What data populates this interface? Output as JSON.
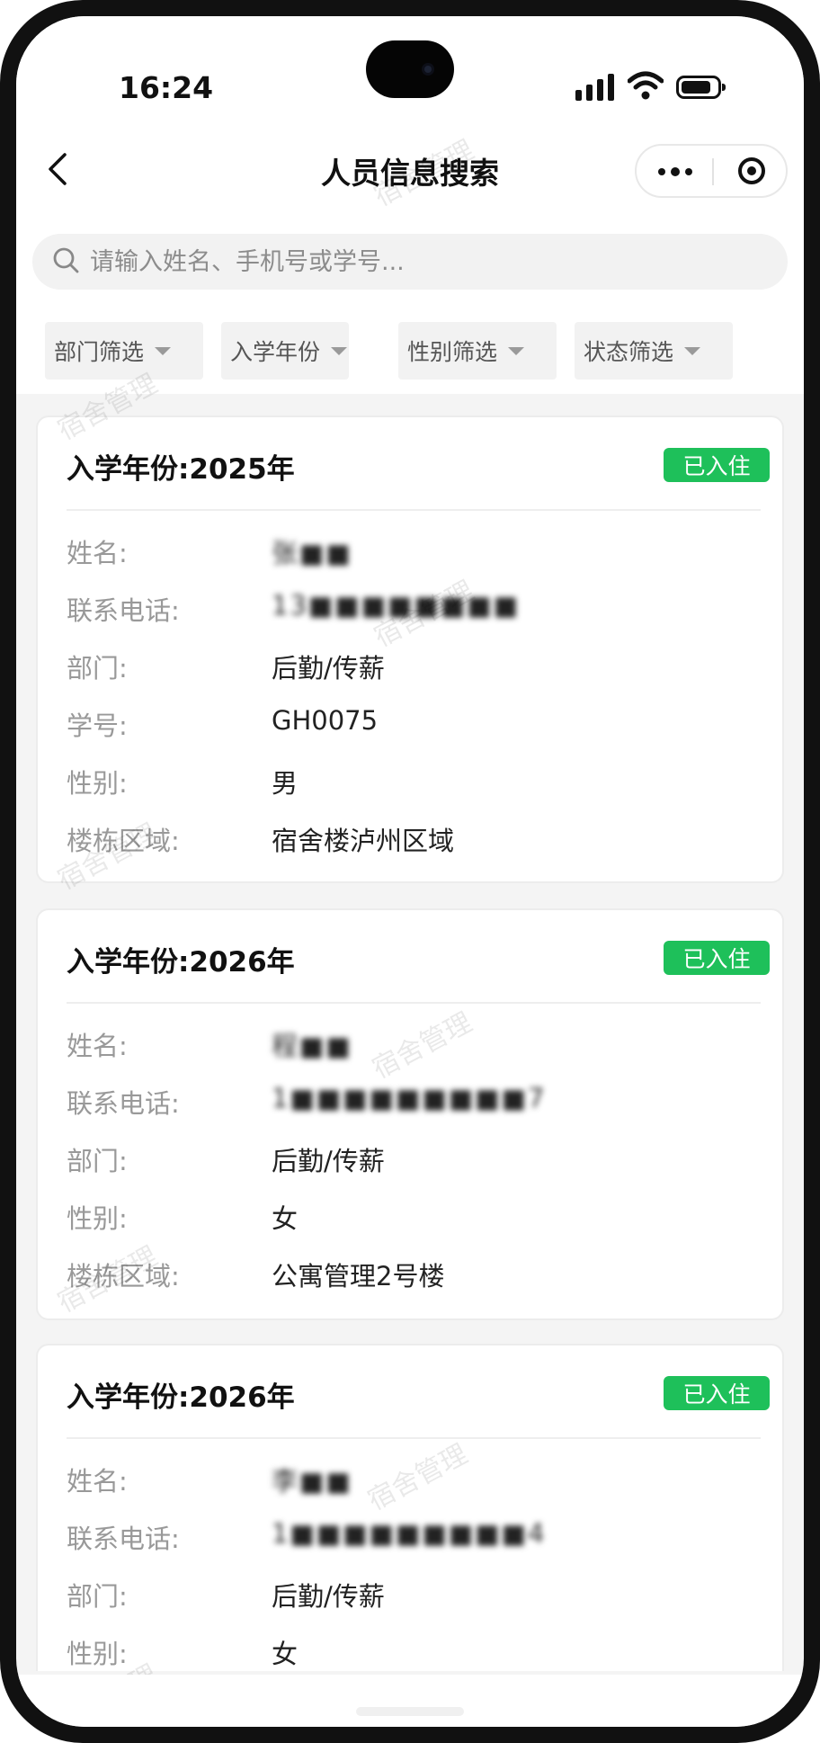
{
  "status_bar": {
    "time": "16:24",
    "battery_icon": "battery-icon",
    "signal_icon": "signal-icon",
    "wifi_icon": "wifi-icon"
  },
  "nav": {
    "title": "人员信息搜索",
    "back_icon": "back-chevron-icon",
    "more_icon": "more-dots-icon",
    "close_icon": "target-circle-icon"
  },
  "search": {
    "placeholder": "请输入姓名、手机号或学号...",
    "value": ""
  },
  "filters": [
    {
      "label": "部门筛选"
    },
    {
      "label": "入学年份"
    },
    {
      "label": "性别筛选"
    },
    {
      "label": "状态筛选"
    }
  ],
  "cards": [
    {
      "title": "入学年份:2025年",
      "status": "已入住",
      "fields": [
        {
          "label": "姓名:",
          "value": "张■■"
        },
        {
          "label": "联系电话:",
          "value": "13■■■■■■■■"
        },
        {
          "label": "部门:",
          "value": "后勤/传薪"
        },
        {
          "label": "学号:",
          "value": "GH0075"
        },
        {
          "label": "性别:",
          "value": "男"
        },
        {
          "label": "楼栋区域:",
          "value": "宿舍楼泸州区域"
        }
      ]
    },
    {
      "title": "入学年份:2026年",
      "status": "已入住",
      "fields": [
        {
          "label": "姓名:",
          "value": "程■■"
        },
        {
          "label": "联系电话:",
          "value": "1■■■■■■■■■7"
        },
        {
          "label": "部门:",
          "value": "后勤/传薪"
        },
        {
          "label": "性别:",
          "value": "女"
        },
        {
          "label": "楼栋区域:",
          "value": "公寓管理2号楼"
        }
      ]
    },
    {
      "title": "入学年份:2026年",
      "status": "已入住",
      "fields": [
        {
          "label": "姓名:",
          "value": "李■■"
        },
        {
          "label": "联系电话:",
          "value": "1■■■■■■■■■4"
        },
        {
          "label": "部门:",
          "value": "后勤/传薪"
        },
        {
          "label": "性别:",
          "value": "女"
        }
      ]
    }
  ],
  "watermark": "宿舍管理",
  "colors": {
    "status_green": "#1ec05a",
    "background": "#f4f4f4"
  }
}
